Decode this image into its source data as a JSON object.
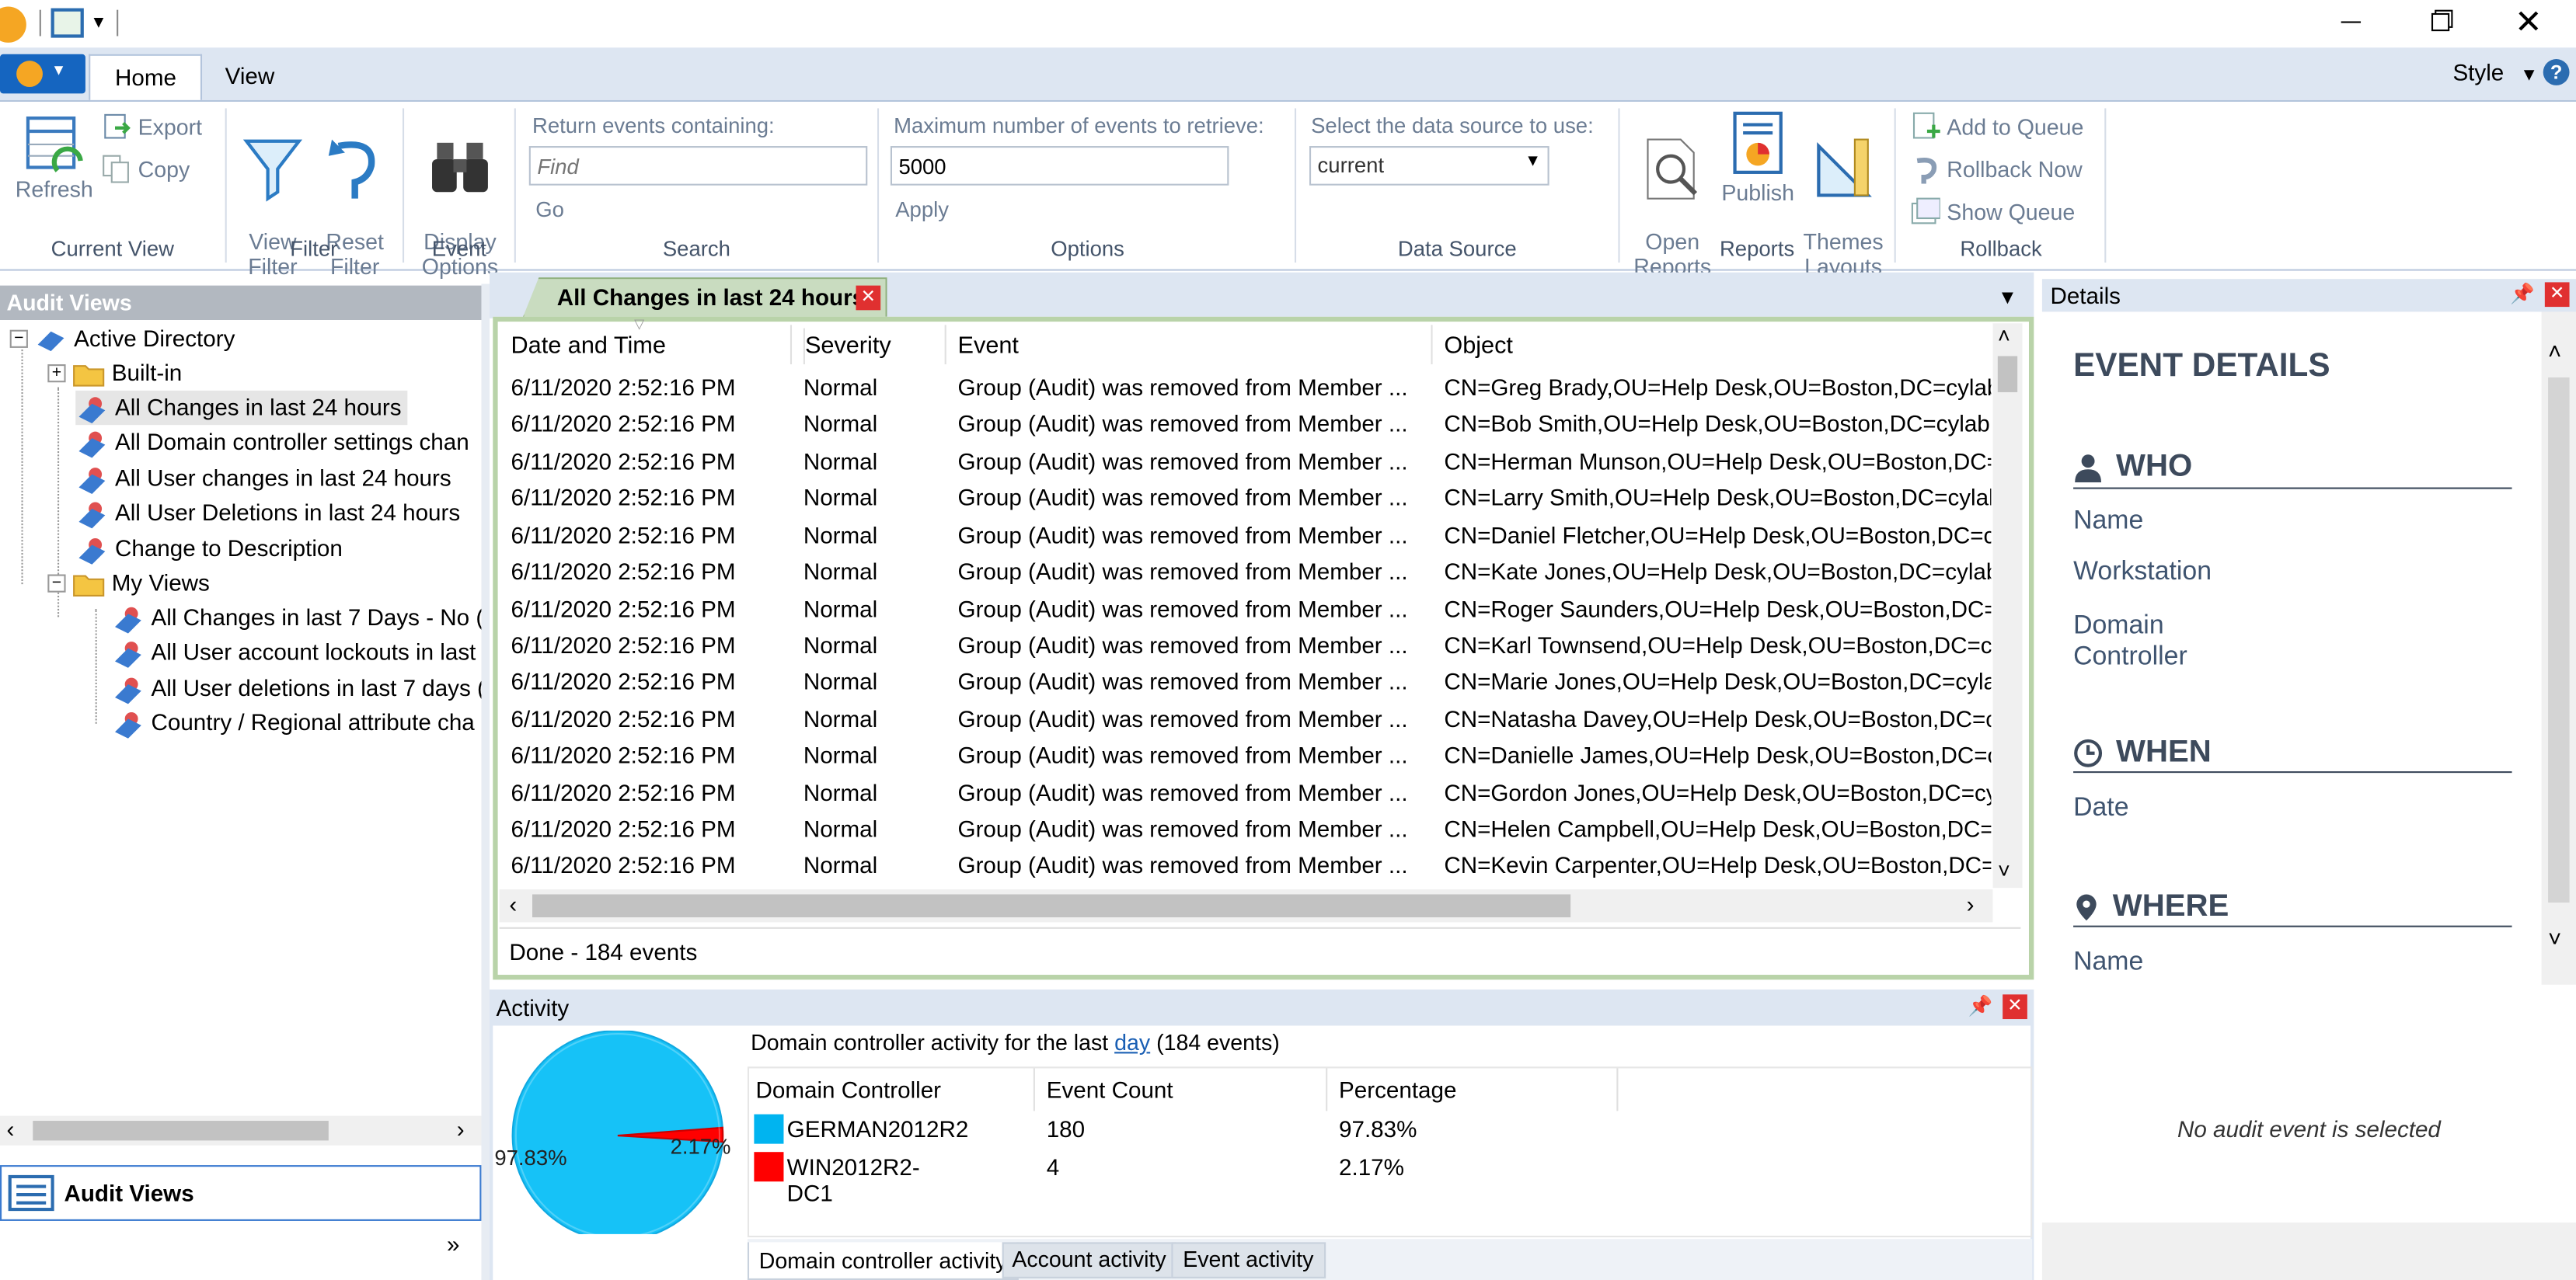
{
  "ribbon": {
    "tabs": [
      "Home",
      "View"
    ],
    "style_label": "Style",
    "groups": {
      "current_view": {
        "label": "Current View",
        "refresh": "Refresh",
        "export": "Export",
        "copy": "Copy"
      },
      "filter": {
        "label": "Filter",
        "view_filter": "View\nFilter",
        "reset_filter": "Reset\nFilter"
      },
      "event": {
        "label": "Event",
        "display_options": "Display\nOptions"
      },
      "search": {
        "label": "Search",
        "caption": "Return events containing:",
        "placeholder": "Find",
        "go": "Go"
      },
      "options": {
        "label": "Options",
        "caption": "Maximum number of events to retrieve:",
        "value": "5000",
        "apply": "Apply"
      },
      "data_source": {
        "label": "Data Source",
        "caption": "Select the data source to use:",
        "value": "current"
      },
      "reports": {
        "label": "Reports",
        "open_reports": "Open\nReports",
        "publish": "Publish",
        "themes_layouts": "Themes\nLayouts"
      },
      "rollback": {
        "label": "Rollback",
        "add_to_queue": "Add to Queue",
        "rollback_now": "Rollback Now",
        "show_queue": "Show Queue"
      }
    }
  },
  "audit_views": {
    "header": "Audit Views",
    "root": "Active Directory",
    "built_in": "Built-in",
    "items": [
      "All Changes in last 24 hours",
      "All Domain controller settings chan",
      "All User changes in last 24 hours",
      "All User Deletions in last 24 hours",
      "Change to Description"
    ],
    "my_views": "My Views",
    "my_items": [
      "All Changes in last 7 Days - No (",
      "All User account lockouts in last",
      "All User deletions in last 7 days (",
      "Country / Regional attribute cha"
    ],
    "nav_button": "Audit Views"
  },
  "grid": {
    "tab_title": "All Changes in last 24 hours",
    "columns": [
      "Date and Time",
      "Severity",
      "Event",
      "Object"
    ],
    "rows": [
      [
        "6/11/2020 2:52:16 PM",
        "Normal",
        "Group (Audit) was removed from Member ...",
        "CN=Greg Brady,OU=Help Desk,OU=Boston,DC=cylab"
      ],
      [
        "6/11/2020 2:52:16 PM",
        "Normal",
        "Group (Audit) was removed from Member ...",
        "CN=Bob Smith,OU=Help Desk,OU=Boston,DC=cylab"
      ],
      [
        "6/11/2020 2:52:16 PM",
        "Normal",
        "Group (Audit) was removed from Member ...",
        "CN=Herman Munson,OU=Help Desk,OU=Boston,DC="
      ],
      [
        "6/11/2020 2:52:16 PM",
        "Normal",
        "Group (Audit) was removed from Member ...",
        "CN=Larry Smith,OU=Help Desk,OU=Boston,DC=cylal"
      ],
      [
        "6/11/2020 2:52:16 PM",
        "Normal",
        "Group (Audit) was removed from Member ...",
        "CN=Daniel Fletcher,OU=Help Desk,OU=Boston,DC=c"
      ],
      [
        "6/11/2020 2:52:16 PM",
        "Normal",
        "Group (Audit) was removed from Member ...",
        "CN=Kate Jones,OU=Help Desk,OU=Boston,DC=cylab:"
      ],
      [
        "6/11/2020 2:52:16 PM",
        "Normal",
        "Group (Audit) was removed from Member ...",
        "CN=Roger Saunders,OU=Help Desk,OU=Boston,DC=("
      ],
      [
        "6/11/2020 2:52:16 PM",
        "Normal",
        "Group (Audit) was removed from Member ...",
        "CN=Karl Townsend,OU=Help Desk,OU=Boston,DC=c"
      ],
      [
        "6/11/2020 2:52:16 PM",
        "Normal",
        "Group (Audit) was removed from Member ...",
        "CN=Marie Jones,OU=Help Desk,OU=Boston,DC=cyla"
      ],
      [
        "6/11/2020 2:52:16 PM",
        "Normal",
        "Group (Audit) was removed from Member ...",
        "CN=Natasha Davey,OU=Help Desk,OU=Boston,DC=c"
      ],
      [
        "6/11/2020 2:52:16 PM",
        "Normal",
        "Group (Audit) was removed from Member ...",
        "CN=Danielle James,OU=Help Desk,OU=Boston,DC=c"
      ],
      [
        "6/11/2020 2:52:16 PM",
        "Normal",
        "Group (Audit) was removed from Member ...",
        "CN=Gordon Jones,OU=Help Desk,OU=Boston,DC=cy"
      ],
      [
        "6/11/2020 2:52:16 PM",
        "Normal",
        "Group (Audit) was removed from Member ...",
        "CN=Helen Campbell,OU=Help Desk,OU=Boston,DC="
      ],
      [
        "6/11/2020 2:52:16 PM",
        "Normal",
        "Group (Audit) was removed from Member ...",
        "CN=Kevin Carpenter,OU=Help Desk,OU=Boston,DC="
      ]
    ],
    "status": "Done - 184 events"
  },
  "activity": {
    "header": "Activity",
    "caption_prefix": "Domain controller activity for the last ",
    "caption_link": "day",
    "caption_suffix": " (184 events)",
    "columns": [
      "Domain Controller",
      "Event Count",
      "Percentage"
    ],
    "rows": [
      {
        "name": "GERMAN2012R2",
        "count": "180",
        "pct": "97.83%",
        "color": "#00b4f0"
      },
      {
        "name": "WIN2012R2-DC1",
        "count": "4",
        "pct": "2.17%",
        "color": "#ff0000"
      }
    ],
    "pie_labels": [
      "97.83%",
      "2.17%"
    ],
    "tabs": [
      "Domain controller activity",
      "Account activity",
      "Event activity"
    ]
  },
  "details": {
    "header": "Details",
    "title": "EVENT DETAILS",
    "who": "WHO",
    "who_fields": [
      "Name",
      "Workstation",
      "Domain\nController"
    ],
    "when": "WHEN",
    "when_fields": [
      "Date"
    ],
    "where": "WHERE",
    "where_fields": [
      "Name"
    ],
    "empty": "No audit event is selected"
  },
  "chart_data": {
    "type": "pie",
    "categories": [
      "GERMAN2012R2",
      "WIN2012R2-DC1"
    ],
    "values": [
      97.83,
      2.17
    ],
    "colors": [
      "#00b4f0",
      "#ff0000"
    ]
  }
}
